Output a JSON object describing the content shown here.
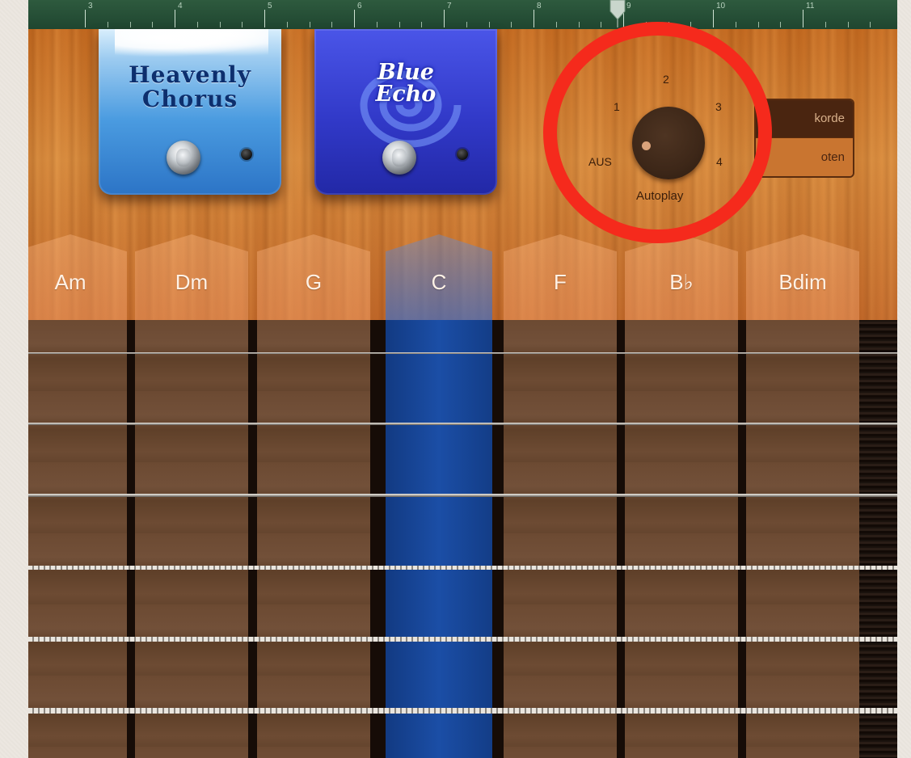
{
  "pedals": {
    "chorus": {
      "name": "Heavenly\nChorus"
    },
    "echo": {
      "name": "Blue\nEcho"
    }
  },
  "autoplay": {
    "title": "Autoplay",
    "positions": [
      "AUS",
      "1",
      "2",
      "3",
      "4"
    ],
    "selected": "AUS"
  },
  "mode_switch": {
    "top_label": "korde",
    "bottom_label": "oten",
    "selected": "top"
  },
  "chords": [
    {
      "label": "Am",
      "selected": false
    },
    {
      "label": "Dm",
      "selected": false
    },
    {
      "label": "G",
      "selected": false
    },
    {
      "label": "C",
      "selected": true
    },
    {
      "label": "F",
      "selected": false
    },
    {
      "label": "B♭",
      "selected": false
    },
    {
      "label": "Bdim",
      "selected": false
    }
  ],
  "ruler": {
    "marks": [
      "3",
      "4",
      "5",
      "6",
      "7",
      "8",
      "9",
      "10",
      "11"
    ]
  },
  "colors": {
    "annotation": "#f52a1c",
    "selected_chord": "#1b4ea6",
    "wood": "#d98b3d",
    "ruler": "#1f4630"
  }
}
